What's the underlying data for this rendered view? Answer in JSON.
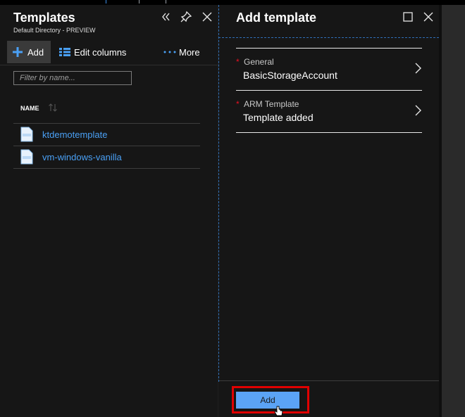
{
  "left_blade": {
    "title": "Templates",
    "subtitle": "Default Directory - PREVIEW",
    "controls": [
      "collapse-icon",
      "pin-icon",
      "close-icon"
    ],
    "toolbar": {
      "add_label": "Add",
      "edit_columns_label": "Edit columns",
      "more_label": "More"
    },
    "filter": {
      "placeholder": "Filter by name...",
      "value": ""
    },
    "table": {
      "column_header": "NAME",
      "rows": [
        {
          "name": "ktdemotemplate",
          "icon": "json-file-icon"
        },
        {
          "name": "vm-windows-vanilla",
          "icon": "json-file-icon"
        }
      ]
    }
  },
  "right_blade": {
    "title": "Add template",
    "controls": [
      "maximize-icon",
      "close-icon"
    ],
    "sections": [
      {
        "label": "General",
        "value": "BasicStorageAccount",
        "required": "*"
      },
      {
        "label": "ARM Template",
        "value": "Template added",
        "required": "*"
      }
    ],
    "add_button_label": "Add"
  },
  "colors": {
    "background": "#161616",
    "link": "#4aa0f5",
    "accent_button": "#5ba3f5",
    "required": "#e81123",
    "highlight": "#e00000"
  }
}
